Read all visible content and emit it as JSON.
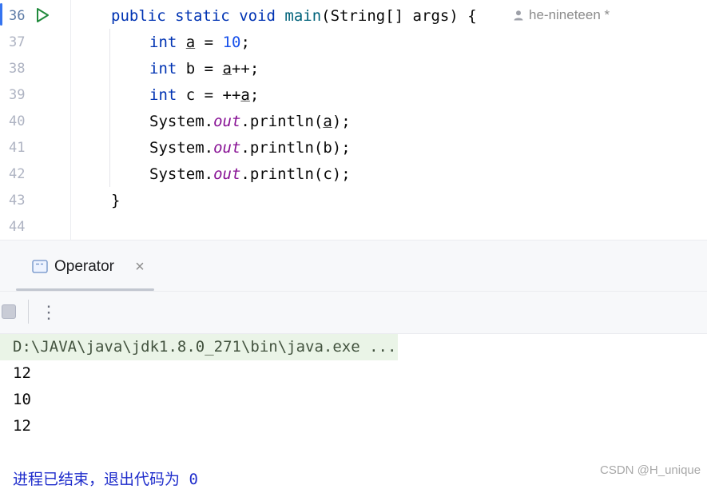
{
  "editor": {
    "line_numbers": [
      "36",
      "37",
      "38",
      "39",
      "40",
      "41",
      "42",
      "43",
      "44"
    ],
    "author_hint": "he-nineteen *",
    "code": {
      "l36": {
        "kw1": "public",
        "kw2": "static",
        "kw3": "void",
        "fn": "main",
        "rest": "(String[] args) {"
      },
      "l37": {
        "kw": "int",
        "var": "a",
        "eq": " = ",
        "num": "10",
        "end": ";"
      },
      "l38": {
        "kw": "int",
        "mid": " b = ",
        "var": "a",
        "end": "++;"
      },
      "l39": {
        "kw": "int",
        "mid": " c = ++",
        "var": "a",
        "end": ";"
      },
      "l40": {
        "pre": "System.",
        "field": "out",
        "mid": ".println(",
        "var": "a",
        "end": ");"
      },
      "l41": {
        "pre": "System.",
        "field": "out",
        "rest": ".println(b);"
      },
      "l42": {
        "pre": "System.",
        "field": "out",
        "rest": ".println(c);"
      },
      "l43": {
        "text": "}"
      }
    }
  },
  "run_panel": {
    "tab_label": "Operator",
    "tab_close": "×",
    "more_label": "⋮",
    "console": {
      "command": "D:\\JAVA\\java\\jdk1.8.0_271\\bin\\java.exe ...",
      "outputs": [
        "12",
        "10",
        "12"
      ],
      "exit_message": "进程已结束，退出代码为 0"
    }
  },
  "watermark": "CSDN @H_unique",
  "icons": {
    "run": "run-icon",
    "user": "user-icon",
    "console_tab": "console-tab-icon",
    "stop": "stop-icon"
  },
  "colors": {
    "keyword": "#0033b3",
    "number": "#1750eb",
    "function": "#00627a",
    "static_field": "#871094",
    "run_green": "#208a3c",
    "exit_text": "#1f2dcc"
  }
}
